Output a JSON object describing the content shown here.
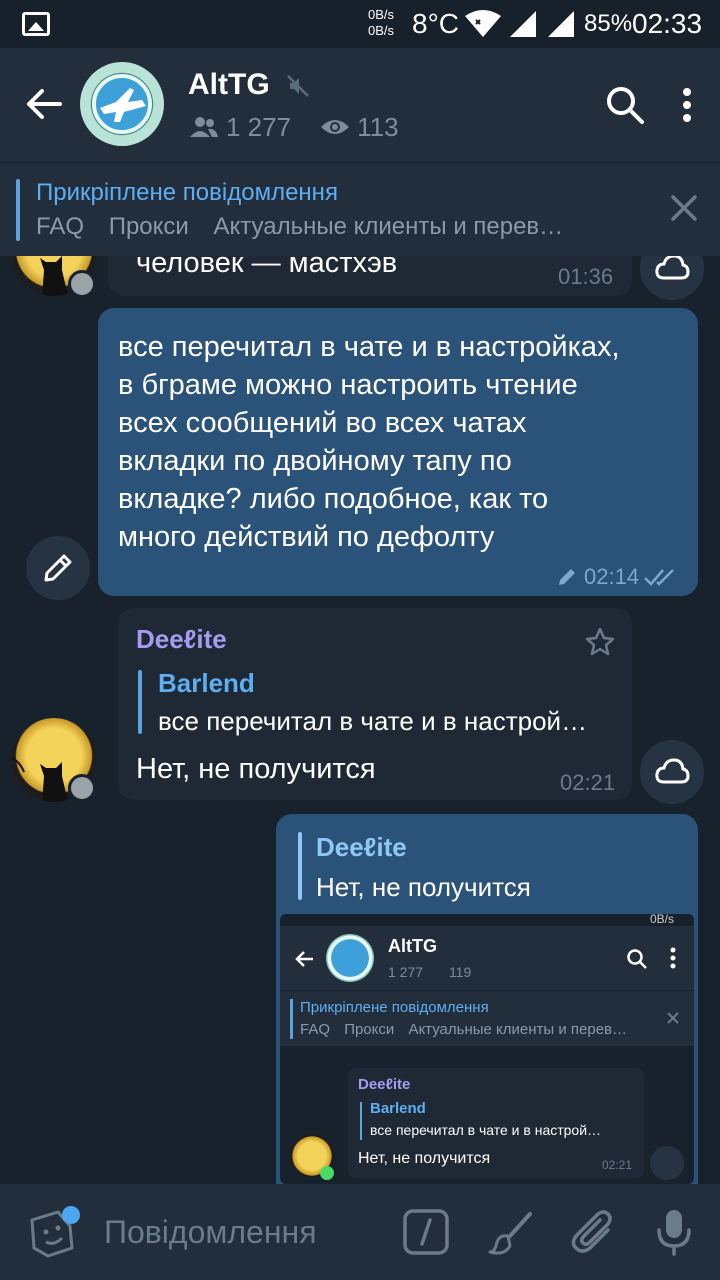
{
  "statusbar": {
    "rate_up": "0B/s",
    "rate_down": "0B/s",
    "temperature": "8°C",
    "battery": "85%",
    "time": "02:33"
  },
  "header": {
    "title": "AltTG",
    "members": "1 277",
    "online": "113"
  },
  "pinned": {
    "title": "Прикріплене повідомлення",
    "items": [
      "FAQ",
      "Прокси",
      "Актуальные клиенты и перев…"
    ]
  },
  "messages": {
    "partial": {
      "text": "человек — мастхэв",
      "time": "01:36"
    },
    "outgoing1": {
      "lines": [
        "все перечитал в чате и в настройках,",
        "в бграме можно настроить чтение",
        "всех сообщений во всех чатах",
        "вкладки по двойному тапу по",
        "вкладке? либо подобное, как то",
        "много действий по дефолту"
      ],
      "time": "02:14"
    },
    "incoming": {
      "sender": "Deeℓite",
      "reply_name": "Barlend",
      "reply_text": "все перечитал в чате и в настрой…",
      "text": "Нет, не получится",
      "time": "02:21"
    },
    "outgoing2": {
      "reply_name": "Deeℓite",
      "reply_text": "Нет, не получится"
    }
  },
  "screenshot": {
    "rate": "0B/s",
    "title": "AltTG",
    "members": "1 277",
    "online": "119",
    "pin_title": "Прикріплене повідомлення",
    "pin_items": [
      "FAQ",
      "Прокси",
      "Актуальные клиенты и перев…"
    ],
    "sender": "Deeℓite",
    "reply_name": "Barlend",
    "reply_text": "все перечитал в чате и в настрой…",
    "text": "Нет, не получится",
    "time": "02:21"
  },
  "input": {
    "placeholder": "Повідомлення"
  },
  "colors": {
    "accent": "#5eaef0",
    "sender_name": "#a69bf0",
    "bubble_out": "#2b5278",
    "bubble_in": "#1e2935"
  }
}
